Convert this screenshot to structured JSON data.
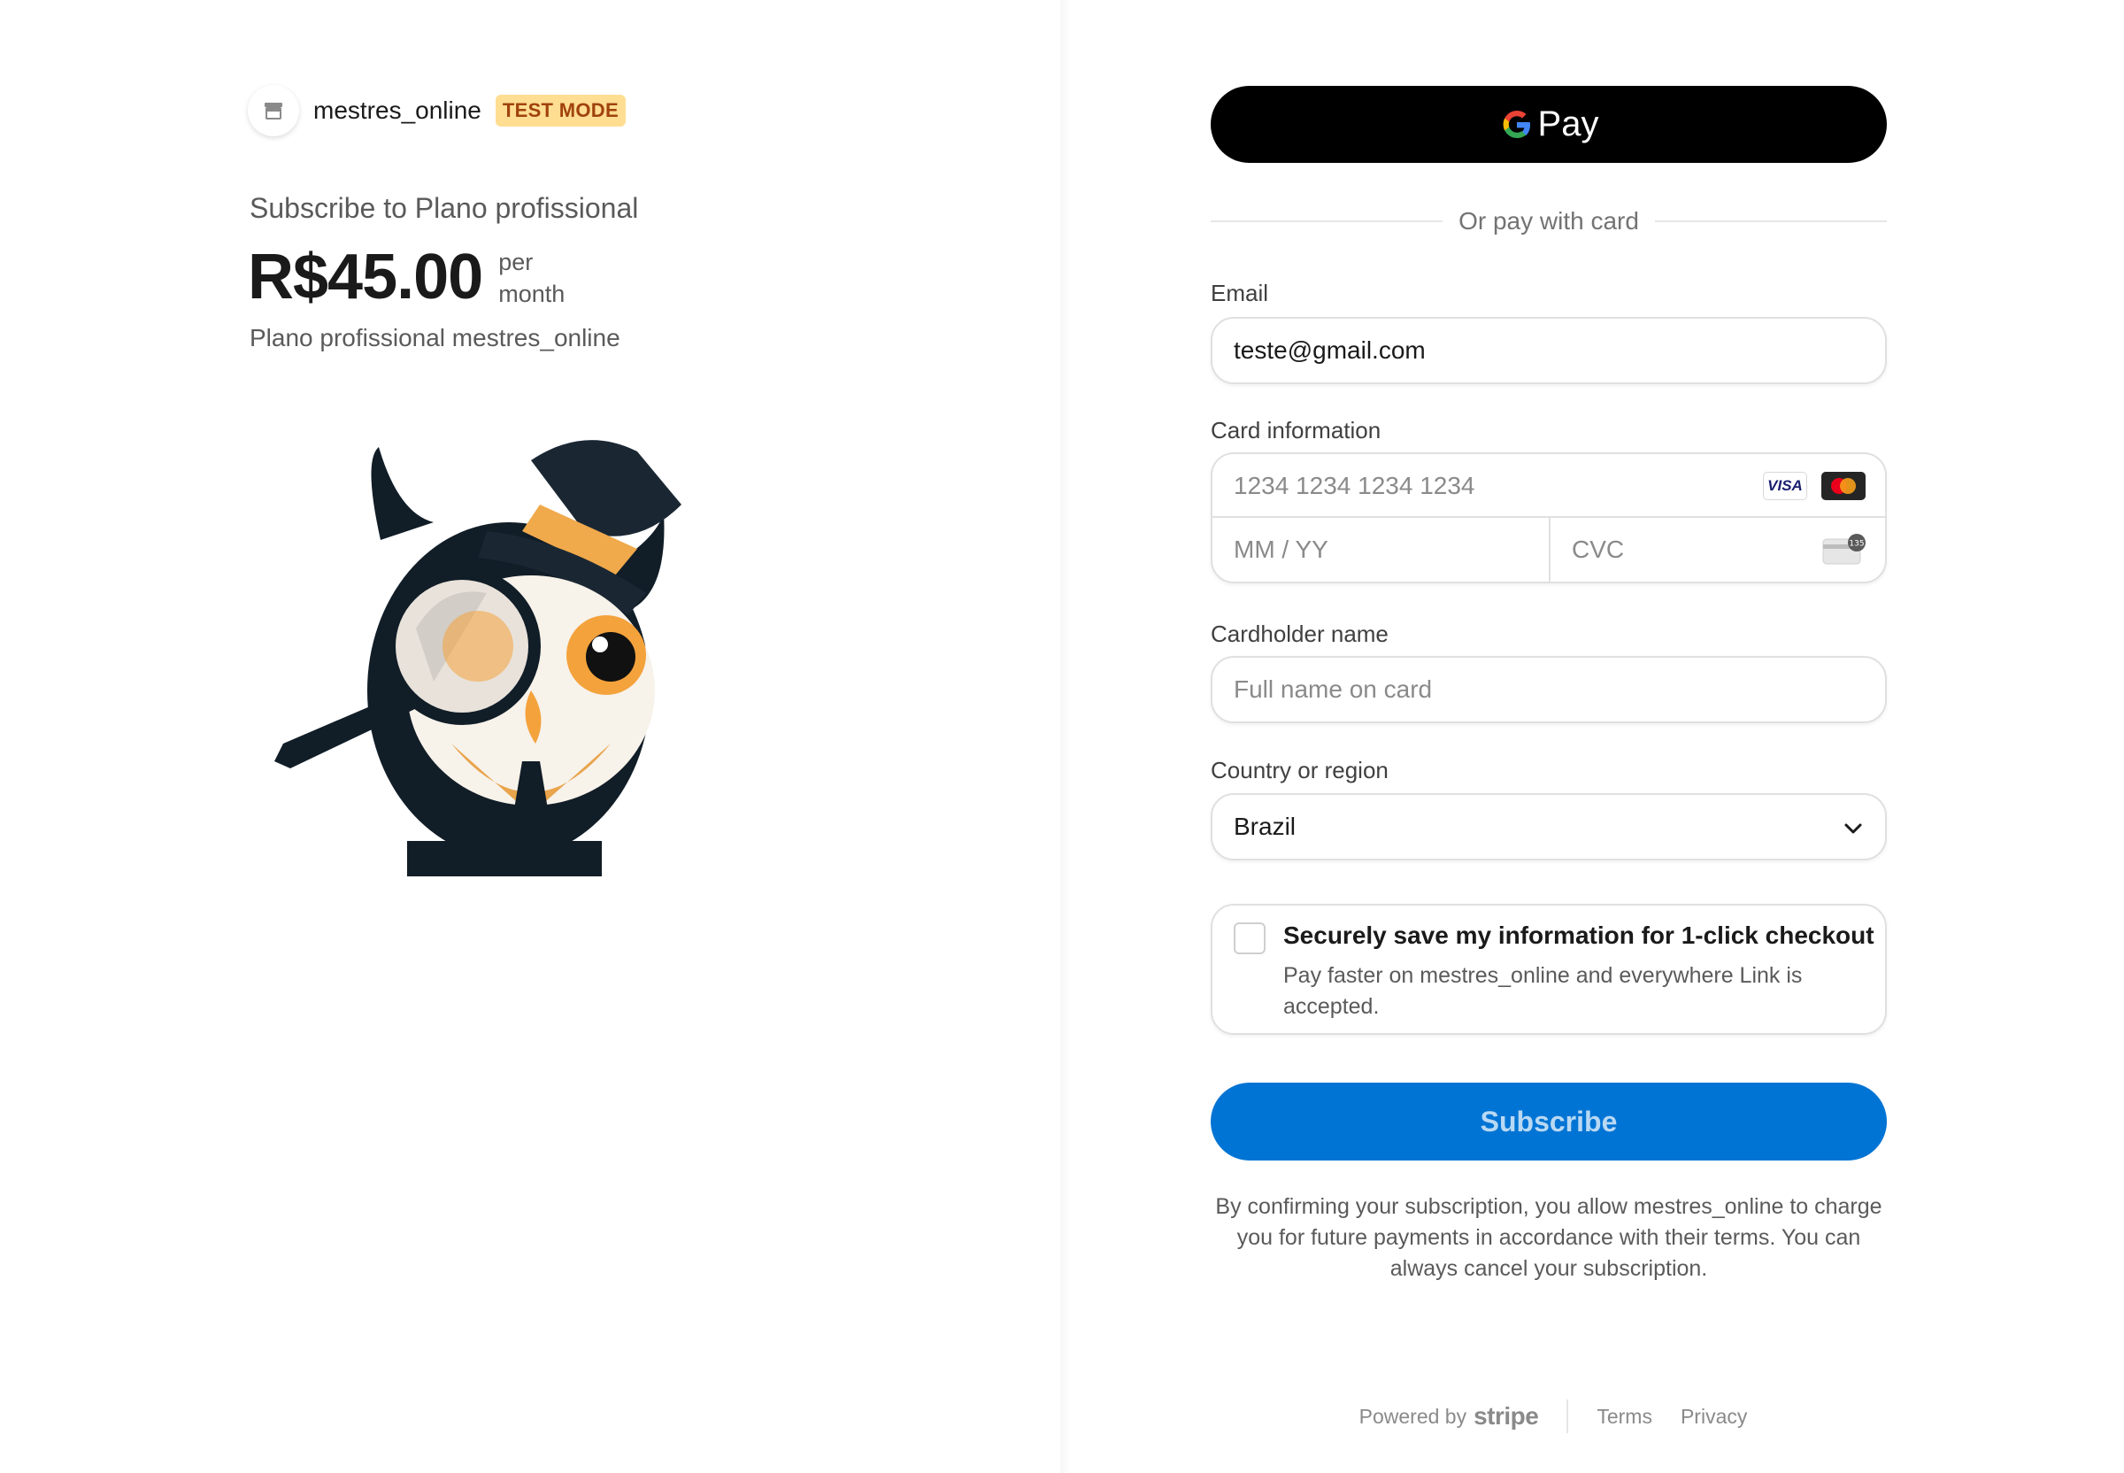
{
  "merchant": {
    "name": "mestres_online",
    "badge": "TEST MODE"
  },
  "summary": {
    "subscribe_title": "Subscribe to Plano profissional",
    "price": "R$45.00",
    "interval_line1": "per",
    "interval_line2": "month",
    "plan_description": "Plano profissional mestres_online"
  },
  "wallet": {
    "gpay_label": "Pay"
  },
  "divider_text": "Or pay with card",
  "email": {
    "label": "Email",
    "value": "teste@gmail.com"
  },
  "card": {
    "label": "Card information",
    "number_placeholder": "1234 1234 1234 1234",
    "expiry_placeholder": "MM / YY",
    "cvc_placeholder": "CVC",
    "brands": [
      "VISA",
      "mastercard"
    ],
    "visa_text": "VISA",
    "cvc_hint": "135"
  },
  "cardholder": {
    "label": "Cardholder name",
    "placeholder": "Full name on card"
  },
  "country": {
    "label": "Country or region",
    "selected": "Brazil"
  },
  "save_info": {
    "checked": false,
    "title": "Securely save my information for 1-click checkout",
    "description": "Pay faster on mestres_online and everywhere Link is accepted."
  },
  "subscribe_button": "Subscribe",
  "terms_text": "By confirming your subscription, you allow mestres_online to charge you for future payments in accordance with their terms. You can always cancel your subscription.",
  "footer": {
    "powered_by": "Powered by",
    "brand": "stripe",
    "terms": "Terms",
    "privacy": "Privacy"
  },
  "colors": {
    "primary": "#0074d4",
    "badge_bg": "#ffde92",
    "badge_text": "#a0420d",
    "gpay_bg": "#000000"
  },
  "icons": [
    "store-icon",
    "owl-mascot-image",
    "google-g-icon",
    "visa-icon",
    "mastercard-icon",
    "cvc-card-icon",
    "chevron-down-icon"
  ]
}
